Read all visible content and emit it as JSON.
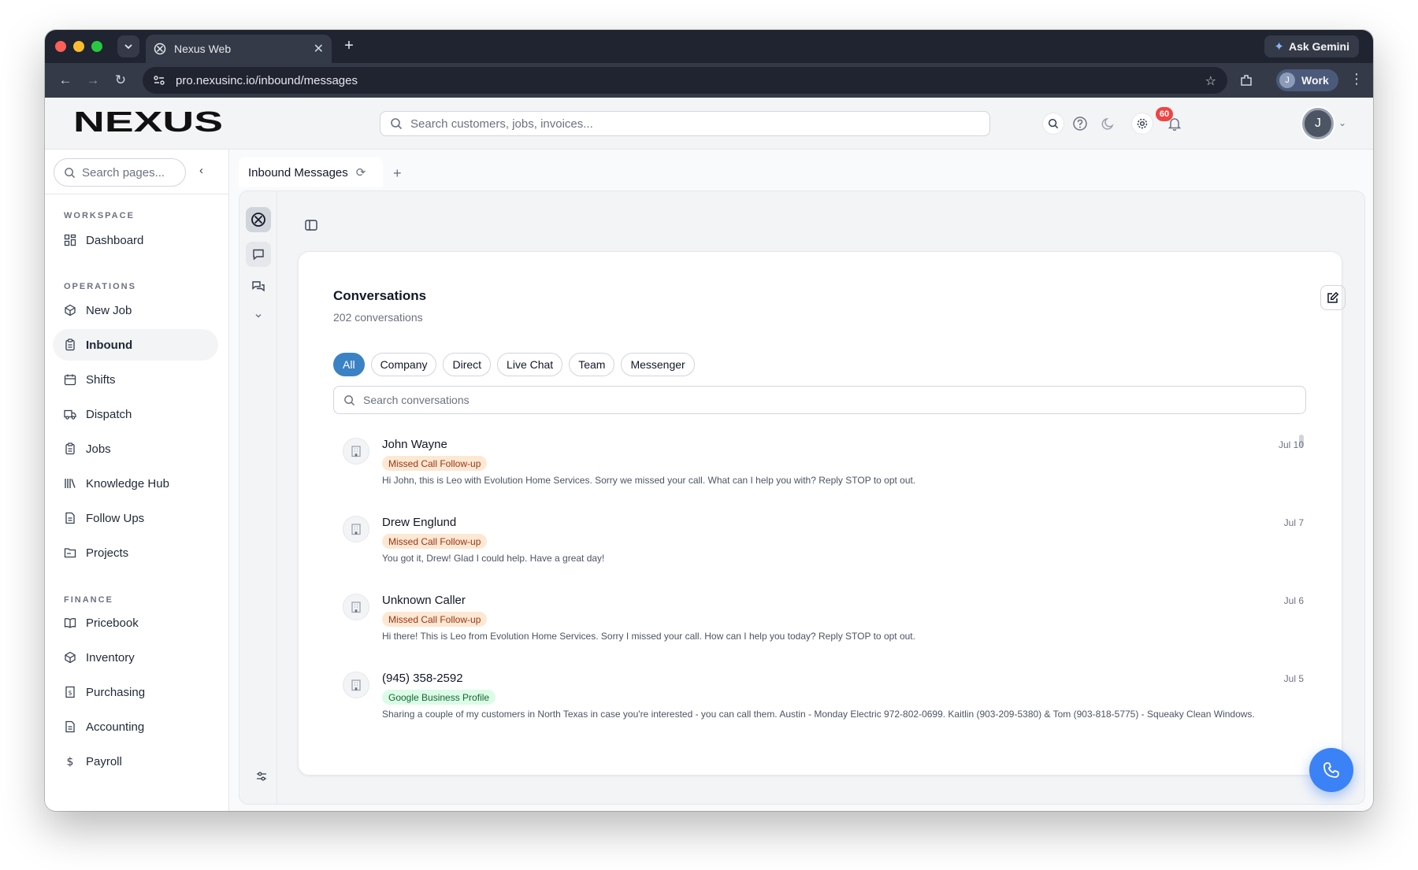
{
  "browser": {
    "tab_title": "Nexus Web",
    "url": "pro.nexusinc.io/inbound/messages",
    "ask_gemini": "Ask Gemini",
    "profile_initial": "J",
    "profile_label": "Work"
  },
  "header": {
    "logo_text": "NEXUS",
    "search_placeholder": "Search customers, jobs, invoices...",
    "notification_count": "60",
    "user_initial": "J"
  },
  "sidebar": {
    "search_placeholder": "Search pages...",
    "sections": [
      {
        "title": "WORKSPACE",
        "items": [
          {
            "label": "Dashboard",
            "icon": "dashboard-icon"
          }
        ]
      },
      {
        "title": "OPERATIONS",
        "items": [
          {
            "label": "New Job",
            "icon": "new-job-icon"
          },
          {
            "label": "Inbound",
            "icon": "clipboard-icon",
            "active": true
          },
          {
            "label": "Shifts",
            "icon": "calendar-icon"
          },
          {
            "label": "Dispatch",
            "icon": "truck-icon"
          },
          {
            "label": "Jobs",
            "icon": "clipboard-icon"
          },
          {
            "label": "Knowledge Hub",
            "icon": "library-icon"
          },
          {
            "label": "Follow Ups",
            "icon": "document-icon"
          },
          {
            "label": "Projects",
            "icon": "folder-icon"
          }
        ]
      },
      {
        "title": "FINANCE",
        "items": [
          {
            "label": "Pricebook",
            "icon": "book-icon"
          },
          {
            "label": "Inventory",
            "icon": "box-icon"
          },
          {
            "label": "Purchasing",
            "icon": "receipt-icon"
          },
          {
            "label": "Accounting",
            "icon": "document-icon"
          },
          {
            "label": "Payroll",
            "icon": "dollar-icon"
          }
        ]
      }
    ]
  },
  "page_tab": {
    "label": "Inbound Messages"
  },
  "conversations": {
    "title": "Conversations",
    "count_label": "202 conversations",
    "filters": [
      "All",
      "Company",
      "Direct",
      "Live Chat",
      "Team",
      "Messenger"
    ],
    "active_filter": "All",
    "search_placeholder": "Search conversations",
    "items": [
      {
        "name": "John Wayne",
        "tag": "Missed Call Follow-up",
        "tag_type": "missed",
        "date": "Jul 10",
        "preview": "Hi John, this is Leo with Evolution Home Services. Sorry we missed your call. What can I help you with? Reply STOP to opt out."
      },
      {
        "name": "Drew Englund",
        "tag": "Missed Call Follow-up",
        "tag_type": "missed",
        "date": "Jul 7",
        "preview": "You got it, Drew! Glad I could help. Have a great day!"
      },
      {
        "name": "Unknown Caller",
        "tag": "Missed Call Follow-up",
        "tag_type": "missed",
        "date": "Jul 6",
        "preview": "Hi there! This is Leo from Evolution Home Services. Sorry I missed your call. How can I help you today? Reply STOP to opt out."
      },
      {
        "name": "(945) 358-2592",
        "tag": "Google Business Profile",
        "tag_type": "gbp",
        "date": "Jul 5",
        "preview": "Sharing a couple of my customers in North Texas in case you're interested - you can call them. Austin - Monday Electric 972-802-0699. Kaitlin (903-209-5380) & Tom (903-818-5775) - Squeaky Clean Windows."
      }
    ]
  },
  "colors": {
    "accent": "#3b82c4",
    "fab": "#3b82f6",
    "badge": "#ef4444"
  }
}
